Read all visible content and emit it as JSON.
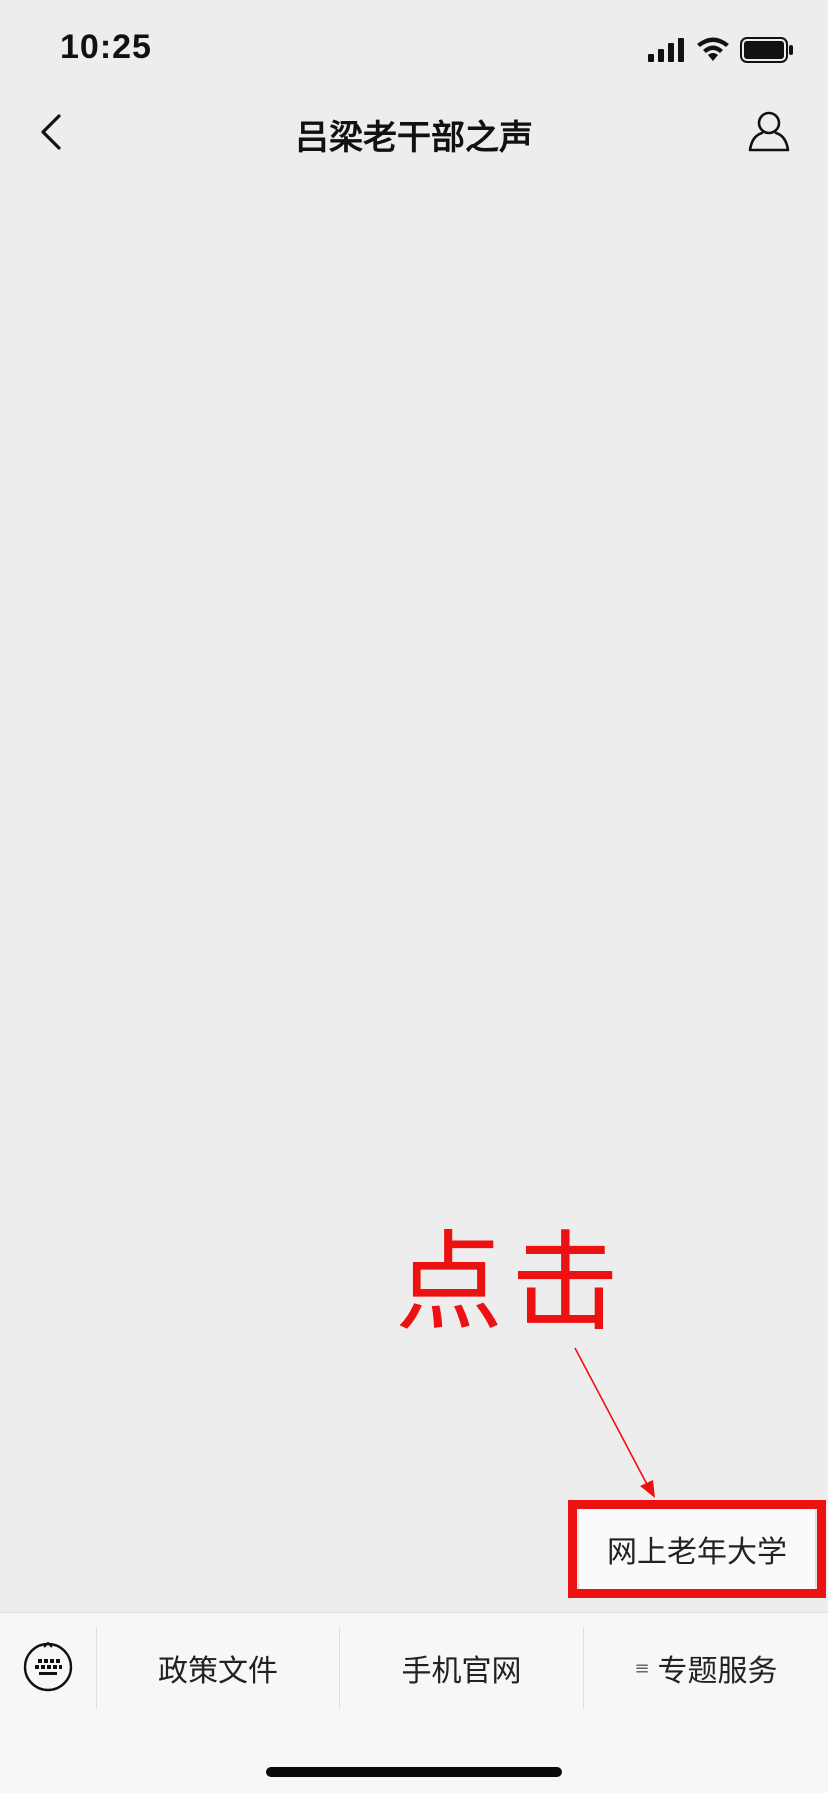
{
  "status_bar": {
    "time": "10:25"
  },
  "nav": {
    "title": "吕梁老干部之声"
  },
  "annotation": {
    "label": "点击",
    "color": "#ee1111"
  },
  "submenu": {
    "item_label": "网上老年大学"
  },
  "menu": {
    "items": [
      {
        "label": "政策文件"
      },
      {
        "label": "手机官网"
      },
      {
        "label": "专题服务",
        "submenu_mark": "≡"
      }
    ]
  }
}
